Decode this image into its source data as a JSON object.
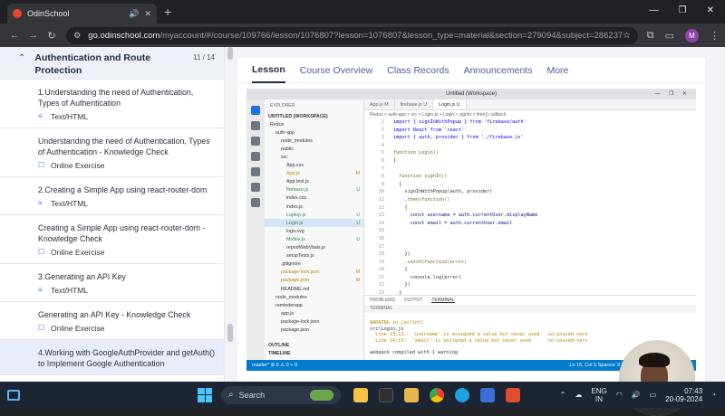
{
  "browser": {
    "tab_title": "OdinSchool",
    "url_domain": "go.odinschool.com",
    "url_path": "/myaccount/#/course/109766/lesson/1076807?lesson=1076807&lesson_type=material&section=279094&subject=286237",
    "profile_initial": "M"
  },
  "sidebar": {
    "section_title": "Authentication and Route Protection",
    "section_count": "11 / 14",
    "lessons": [
      {
        "title": "1.Understanding the need of Authentication, Types of Authentication",
        "type": "Text/HTML",
        "icon": "document-icon"
      },
      {
        "title": "Understanding the need of Authentication, Types of Authentication - Knowledge Check",
        "type": "Online Exercise",
        "icon": "exercise-icon"
      },
      {
        "title": "2.Creating a Simple App using react-router-dom",
        "type": "Text/HTML",
        "icon": "document-icon"
      },
      {
        "title": "Creating a Simple App using react-router-dom - Knowledge Check",
        "type": "Online Exercise",
        "icon": "exercise-icon"
      },
      {
        "title": "3.Generating an API Key",
        "type": "Text/HTML",
        "icon": "document-icon"
      },
      {
        "title": "Generating an API Key - Knowledge Check",
        "type": "Online Exercise",
        "icon": "exercise-icon"
      },
      {
        "title": "4.Working with GoogleAuthProvider and getAuth() to Implement Google Authentication",
        "type": "",
        "icon": "document-icon"
      }
    ]
  },
  "main": {
    "tabs": [
      "Lesson",
      "Course Overview",
      "Class Records",
      "Announcements",
      "More"
    ],
    "active_tab": "Lesson"
  },
  "video": {
    "window_title": "Untitled (Workspace)",
    "explorer_header": "EXPLORER",
    "workspace": "UNTITLED (WORKSPACE)",
    "files": [
      {
        "name": "Redux",
        "indent": 1,
        "status": "",
        "kind": "folder"
      },
      {
        "name": "auth-app",
        "indent": 2,
        "status": "",
        "kind": "folder"
      },
      {
        "name": "node_modules",
        "indent": 3,
        "status": "",
        "kind": "folder"
      },
      {
        "name": "public",
        "indent": 3,
        "status": "",
        "kind": "folder"
      },
      {
        "name": "src",
        "indent": 3,
        "status": "",
        "kind": "folder"
      },
      {
        "name": "App.css",
        "indent": 4,
        "status": "",
        "kind": "file"
      },
      {
        "name": "App.js",
        "indent": 4,
        "status": "M",
        "kind": "file"
      },
      {
        "name": "App.test.js",
        "indent": 4,
        "status": "",
        "kind": "file"
      },
      {
        "name": "firebase.js",
        "indent": 4,
        "status": "U",
        "kind": "file"
      },
      {
        "name": "index.css",
        "indent": 4,
        "status": "",
        "kind": "file"
      },
      {
        "name": "index.js",
        "indent": 4,
        "status": "",
        "kind": "file"
      },
      {
        "name": "Laptop.js",
        "indent": 4,
        "status": "U",
        "kind": "file"
      },
      {
        "name": "Login.js",
        "indent": 4,
        "status": "U",
        "kind": "file",
        "selected": true
      },
      {
        "name": "logo.svg",
        "indent": 4,
        "status": "",
        "kind": "file"
      },
      {
        "name": "Mobile.js",
        "indent": 4,
        "status": "U",
        "kind": "file"
      },
      {
        "name": "reportWebVitals.js",
        "indent": 4,
        "status": "",
        "kind": "file"
      },
      {
        "name": "setupTests.js",
        "indent": 4,
        "status": "",
        "kind": "file"
      },
      {
        "name": ".gitignore",
        "indent": 3,
        "status": "",
        "kind": "file"
      },
      {
        "name": "package-lock.json",
        "indent": 3,
        "status": "M",
        "kind": "file"
      },
      {
        "name": "package.json",
        "indent": 3,
        "status": "M",
        "kind": "file"
      },
      {
        "name": "README.md",
        "indent": 3,
        "status": "",
        "kind": "file"
      },
      {
        "name": "node_modules",
        "indent": 2,
        "status": "",
        "kind": "folder"
      },
      {
        "name": "reminderapp",
        "indent": 2,
        "status": "",
        "kind": "folder"
      },
      {
        "name": "app.js",
        "indent": 3,
        "status": "",
        "kind": "file"
      },
      {
        "name": "package-lock.json",
        "indent": 3,
        "status": "",
        "kind": "file"
      },
      {
        "name": "package.json",
        "indent": 3,
        "status": "",
        "kind": "file"
      }
    ],
    "outline": "OUTLINE",
    "timeline": "TIMELINE",
    "editor_tabs": [
      "App.js M",
      "firebase.js U",
      "Login.js U"
    ],
    "breadcrumb": "Redux > auth-app > src > Login.js > Login > signIn > then() callback",
    "code": [
      "import { signInWithPopup } from 'firebase/auth'",
      "import React from 'react'",
      "import { auth, provider } from './firebase.js'",
      "",
      "function Login()",
      "{",
      "",
      "  function signIn()",
      "  {",
      "    signInWithPopup(auth, provider)",
      "    .then(function()",
      "    {",
      "      const username = auth.currentUser.displayName",
      "      const email = auth.currentUser.email",
      "",
      "",
      "",
      "    })",
      "    .catch(function(error)",
      "    {",
      "      console.log(error)",
      "    })",
      "  }",
      ""
    ],
    "terminal_tabs": [
      "PROBLEMS",
      "OUTPUT",
      "TERMINAL"
    ],
    "terminal_label": "TERMINAL",
    "terminal_lines": [
      "WARNING in [eslint]",
      "src\\Login.js",
      "  Line 13:13:  'username' is assigned a value but never used   no-unused-vars",
      "  Line 14:13:  'email' is assigned a value but never used      no-unused-vars",
      "",
      "webpack compiled with 1 warning"
    ],
    "status_left": "master*   ⊗ 0 ⚠ 0   ⑂ 0",
    "status_right": "Ln 16, Col 5   Spaces: 2   UTF-8   LF   {} JavaScript   Go Live"
  },
  "taskbar": {
    "search_placeholder": "Search",
    "language": "ENG",
    "region": "IN",
    "time": "07:43",
    "date": "20-09-2024"
  }
}
